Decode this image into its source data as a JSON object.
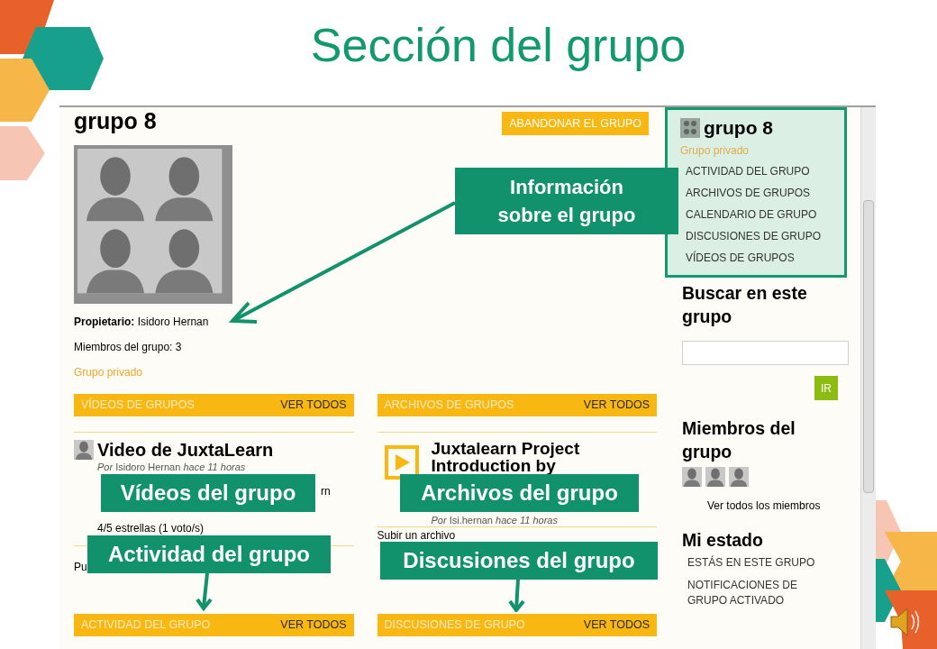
{
  "slide_title": "Sección del grupo",
  "page": {
    "title": "grupo 8",
    "leave_button": "ABANDONAR EL GRUPO",
    "owner_label": "Propietario:",
    "owner": "Isidoro Hernan",
    "members_count": "Miembros del grupo: 3",
    "privacy": "Grupo privado"
  },
  "videos_module": {
    "title": "VÍDEOS DE GRUPOS",
    "link": "VER TODOS",
    "item_title": "Video de JuxtaLearn",
    "byline": "*Por* Isidoro Hernan *hace 11 horas*",
    "fragment": "rn",
    "rating": "4/5 estrellas (1 voto/s)"
  },
  "files_module": {
    "title": "ARCHIVOS DE GRUPOS",
    "link": "VER TODOS",
    "item_title": "Juxtalearn Project Introduction by",
    "byline": "*Por* Isi.hernan *hace 11 horas*",
    "upload_link": "Subir un archivo"
  },
  "activity_module": {
    "title": "ACTIVIDAD DEL GRUPO",
    "link": "VER TODOS",
    "fragment": "Pu"
  },
  "discussions_module": {
    "title": "DISCUSIONES DE GRUPO",
    "link": "VER TODOS"
  },
  "sidebar": {
    "group_title": "grupo 8",
    "privacy": "Grupo privado",
    "menu": [
      "ACTIVIDAD DEL GRUPO",
      "ARCHIVOS DE GRUPOS",
      "CALENDARIO DE GRUPO",
      "DISCUSIONES DE GRUPO",
      "VÍDEOS DE GRUPOS"
    ],
    "search_heading": "Buscar en este grupo",
    "search_button": "IR",
    "members_heading": "Miembros del grupo",
    "member_avatars": [
      {
        "kind": "avatar"
      },
      {
        "kind": "avatar"
      },
      {
        "kind": "avatar"
      }
    ],
    "members_link": "Ver todos los miembros",
    "status_heading": "Mi estado",
    "status_items": [
      "ESTÁS EN ESTE GRUPO",
      "NOTIFICACIONES DE GRUPO ACTIVADO"
    ]
  },
  "callouts": [
    {
      "text": "Información sobre el grupo"
    },
    {
      "text": "Vídeos del grupo"
    },
    {
      "text": "Archivos del grupo"
    },
    {
      "text": "Actividad del grupo"
    },
    {
      "text": "Discusiones del grupo"
    }
  ]
}
